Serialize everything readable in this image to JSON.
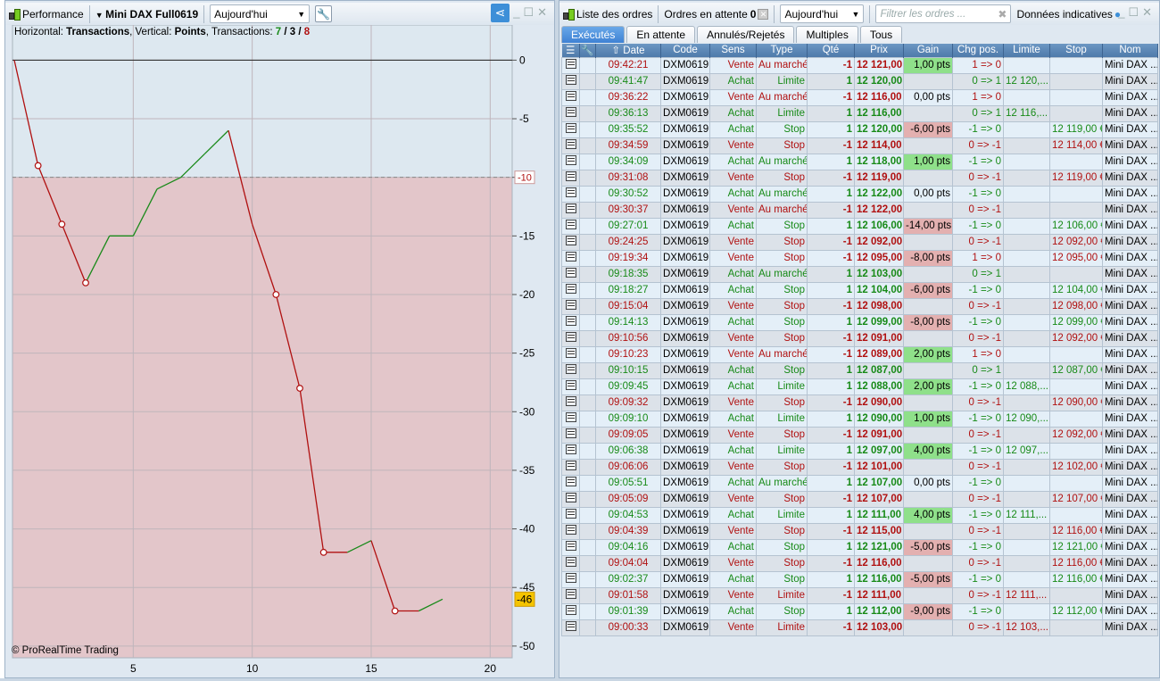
{
  "left_panel": {
    "title": "Performance",
    "instrument": "Mini DAX Full0619",
    "period": "Aujourd'hui",
    "info": {
      "h_label": "Horizontal: ",
      "h_value": "Transactions",
      "v_label": ", Vertical: ",
      "v_value": "Points",
      "t_label": ", Transactions: ",
      "wins": "7",
      "sep1": " / ",
      "neutral": "3",
      "sep2": " / ",
      "losses": "8"
    },
    "copyright": "© ProRealTime Trading"
  },
  "chart_data": {
    "type": "line",
    "title": "Performance",
    "xlabel": "Transactions",
    "ylabel": "Points",
    "x": [
      0,
      1,
      2,
      3,
      4,
      5,
      6,
      7,
      8,
      9,
      10,
      11,
      12,
      13,
      14,
      15,
      16,
      17,
      18
    ],
    "y": [
      0,
      -9,
      -14,
      -19,
      -15,
      -15,
      -11,
      -10,
      -8,
      -6,
      -14,
      -20,
      -28,
      -42,
      -42,
      -41,
      -47,
      -47,
      -46
    ],
    "segment_colors": [
      "red",
      "red",
      "red",
      "green",
      "green",
      "green",
      "green",
      "green",
      "green",
      "red",
      "red",
      "red",
      "red",
      "red",
      "green",
      "red",
      "red",
      "green"
    ],
    "marker_points": [
      1,
      2,
      3,
      11,
      12,
      13,
      16
    ],
    "xlim": [
      0,
      21
    ],
    "ylim": [
      -51,
      3
    ],
    "xticks": [
      5,
      10,
      15,
      20
    ],
    "yticks": [
      0,
      -5,
      -10,
      -15,
      -20,
      -25,
      -30,
      -35,
      -40,
      -45,
      -50
    ],
    "threshold": -10,
    "threshold_label": "-10",
    "last_value_label": "-46",
    "colors": {
      "up": "#1a8a1a",
      "down": "#b01010",
      "above": "#dde8f0",
      "below": "#e3c6ca",
      "last": "#f5c400"
    }
  },
  "right_panel": {
    "title": "Liste des ordres",
    "pending_label": "Ordres en attente",
    "pending_count": "0",
    "period": "Aujourd'hui",
    "filter_placeholder": "Filtrer les ordres ...",
    "indicative": "Données indicatives",
    "tabs": [
      "Exécutés",
      "En attente",
      "Annulés/Rejetés",
      "Multiples",
      "Tous"
    ],
    "columns": [
      "Date",
      "Code",
      "Sens",
      "Type",
      "Qté",
      "Prix",
      "Gain",
      "Chg pos.",
      "Limite",
      "Stop",
      "Nom"
    ],
    "rows": [
      [
        "09:42:21",
        "DXM0619",
        "Vente",
        "Au marché",
        "-1",
        "12 121,00",
        "1,00 pts",
        "1 => 0",
        "",
        "",
        "Mini DAX ..."
      ],
      [
        "09:41:47",
        "DXM0619",
        "Achat",
        "Limite",
        "1",
        "12 120,00",
        "",
        "0 => 1",
        "12 120,...",
        "",
        "Mini DAX ..."
      ],
      [
        "09:36:22",
        "DXM0619",
        "Vente",
        "Au marché",
        "-1",
        "12 116,00",
        "0,00 pts",
        "1 => 0",
        "",
        "",
        "Mini DAX ..."
      ],
      [
        "09:36:13",
        "DXM0619",
        "Achat",
        "Limite",
        "1",
        "12 116,00",
        "",
        "0 => 1",
        "12 116,...",
        "",
        "Mini DAX ..."
      ],
      [
        "09:35:52",
        "DXM0619",
        "Achat",
        "Stop",
        "1",
        "12 120,00",
        "-6,00 pts",
        "-1 => 0",
        "",
        "12 119,00 €",
        "Mini DAX ..."
      ],
      [
        "09:34:59",
        "DXM0619",
        "Vente",
        "Stop",
        "-1",
        "12 114,00",
        "",
        "0 => -1",
        "",
        "12 114,00 €",
        "Mini DAX ..."
      ],
      [
        "09:34:09",
        "DXM0619",
        "Achat",
        "Au marché",
        "1",
        "12 118,00",
        "1,00 pts",
        "-1 => 0",
        "",
        "",
        "Mini DAX ..."
      ],
      [
        "09:31:08",
        "DXM0619",
        "Vente",
        "Stop",
        "-1",
        "12 119,00",
        "",
        "0 => -1",
        "",
        "12 119,00 €",
        "Mini DAX ..."
      ],
      [
        "09:30:52",
        "DXM0619",
        "Achat",
        "Au marché",
        "1",
        "12 122,00",
        "0,00 pts",
        "-1 => 0",
        "",
        "",
        "Mini DAX ..."
      ],
      [
        "09:30:37",
        "DXM0619",
        "Vente",
        "Au marché",
        "-1",
        "12 122,00",
        "",
        "0 => -1",
        "",
        "",
        "Mini DAX ..."
      ],
      [
        "09:27:01",
        "DXM0619",
        "Achat",
        "Stop",
        "1",
        "12 106,00",
        "-14,00 pts",
        "-1 => 0",
        "",
        "12 106,00 €",
        "Mini DAX ..."
      ],
      [
        "09:24:25",
        "DXM0619",
        "Vente",
        "Stop",
        "-1",
        "12 092,00",
        "",
        "0 => -1",
        "",
        "12 092,00 €",
        "Mini DAX ..."
      ],
      [
        "09:19:34",
        "DXM0619",
        "Vente",
        "Stop",
        "-1",
        "12 095,00",
        "-8,00 pts",
        "1 => 0",
        "",
        "12 095,00 €",
        "Mini DAX ..."
      ],
      [
        "09:18:35",
        "DXM0619",
        "Achat",
        "Au marché",
        "1",
        "12 103,00",
        "",
        "0 => 1",
        "",
        "",
        "Mini DAX ..."
      ],
      [
        "09:18:27",
        "DXM0619",
        "Achat",
        "Stop",
        "1",
        "12 104,00",
        "-6,00 pts",
        "-1 => 0",
        "",
        "12 104,00 €",
        "Mini DAX ..."
      ],
      [
        "09:15:04",
        "DXM0619",
        "Vente",
        "Stop",
        "-1",
        "12 098,00",
        "",
        "0 => -1",
        "",
        "12 098,00 €",
        "Mini DAX ..."
      ],
      [
        "09:14:13",
        "DXM0619",
        "Achat",
        "Stop",
        "1",
        "12 099,00",
        "-8,00 pts",
        "-1 => 0",
        "",
        "12 099,00 €",
        "Mini DAX ..."
      ],
      [
        "09:10:56",
        "DXM0619",
        "Vente",
        "Stop",
        "-1",
        "12 091,00",
        "",
        "0 => -1",
        "",
        "12 092,00 €",
        "Mini DAX ..."
      ],
      [
        "09:10:23",
        "DXM0619",
        "Vente",
        "Au marché",
        "-1",
        "12 089,00",
        "2,00 pts",
        "1 => 0",
        "",
        "",
        "Mini DAX ..."
      ],
      [
        "09:10:15",
        "DXM0619",
        "Achat",
        "Stop",
        "1",
        "12 087,00",
        "",
        "0 => 1",
        "",
        "12 087,00 €",
        "Mini DAX ..."
      ],
      [
        "09:09:45",
        "DXM0619",
        "Achat",
        "Limite",
        "1",
        "12 088,00",
        "2,00 pts",
        "-1 => 0",
        "12 088,...",
        "",
        "Mini DAX ..."
      ],
      [
        "09:09:32",
        "DXM0619",
        "Vente",
        "Stop",
        "-1",
        "12 090,00",
        "",
        "0 => -1",
        "",
        "12 090,00 €",
        "Mini DAX ..."
      ],
      [
        "09:09:10",
        "DXM0619",
        "Achat",
        "Limite",
        "1",
        "12 090,00",
        "1,00 pts",
        "-1 => 0",
        "12 090,...",
        "",
        "Mini DAX ..."
      ],
      [
        "09:09:05",
        "DXM0619",
        "Vente",
        "Stop",
        "-1",
        "12 091,00",
        "",
        "0 => -1",
        "",
        "12 092,00 €",
        "Mini DAX ..."
      ],
      [
        "09:06:38",
        "DXM0619",
        "Achat",
        "Limite",
        "1",
        "12 097,00",
        "4,00 pts",
        "-1 => 0",
        "12 097,...",
        "",
        "Mini DAX ..."
      ],
      [
        "09:06:06",
        "DXM0619",
        "Vente",
        "Stop",
        "-1",
        "12 101,00",
        "",
        "0 => -1",
        "",
        "12 102,00 €",
        "Mini DAX ..."
      ],
      [
        "09:05:51",
        "DXM0619",
        "Achat",
        "Au marché",
        "1",
        "12 107,00",
        "0,00 pts",
        "-1 => 0",
        "",
        "",
        "Mini DAX ..."
      ],
      [
        "09:05:09",
        "DXM0619",
        "Vente",
        "Stop",
        "-1",
        "12 107,00",
        "",
        "0 => -1",
        "",
        "12 107,00 €",
        "Mini DAX ..."
      ],
      [
        "09:04:53",
        "DXM0619",
        "Achat",
        "Limite",
        "1",
        "12 111,00",
        "4,00 pts",
        "-1 => 0",
        "12 111,...",
        "",
        "Mini DAX ..."
      ],
      [
        "09:04:39",
        "DXM0619",
        "Vente",
        "Stop",
        "-1",
        "12 115,00",
        "",
        "0 => -1",
        "",
        "12 116,00 €",
        "Mini DAX ..."
      ],
      [
        "09:04:16",
        "DXM0619",
        "Achat",
        "Stop",
        "1",
        "12 121,00",
        "-5,00 pts",
        "-1 => 0",
        "",
        "12 121,00 €",
        "Mini DAX ..."
      ],
      [
        "09:04:04",
        "DXM0619",
        "Vente",
        "Stop",
        "-1",
        "12 116,00",
        "",
        "0 => -1",
        "",
        "12 116,00 €",
        "Mini DAX ..."
      ],
      [
        "09:02:37",
        "DXM0619",
        "Achat",
        "Stop",
        "1",
        "12 116,00",
        "-5,00 pts",
        "-1 => 0",
        "",
        "12 116,00 €",
        "Mini DAX ..."
      ],
      [
        "09:01:58",
        "DXM0619",
        "Vente",
        "Limite",
        "-1",
        "12 111,00",
        "",
        "0 => -1",
        "12 111,...",
        "",
        "Mini DAX ..."
      ],
      [
        "09:01:39",
        "DXM0619",
        "Achat",
        "Stop",
        "1",
        "12 112,00",
        "-9,00 pts",
        "-1 => 0",
        "",
        "12 112,00 €",
        "Mini DAX ..."
      ],
      [
        "09:00:33",
        "DXM0619",
        "Vente",
        "Limite",
        "-1",
        "12 103,00",
        "",
        "0 => -1",
        "12 103,...",
        "",
        "Mini DAX ..."
      ]
    ]
  }
}
